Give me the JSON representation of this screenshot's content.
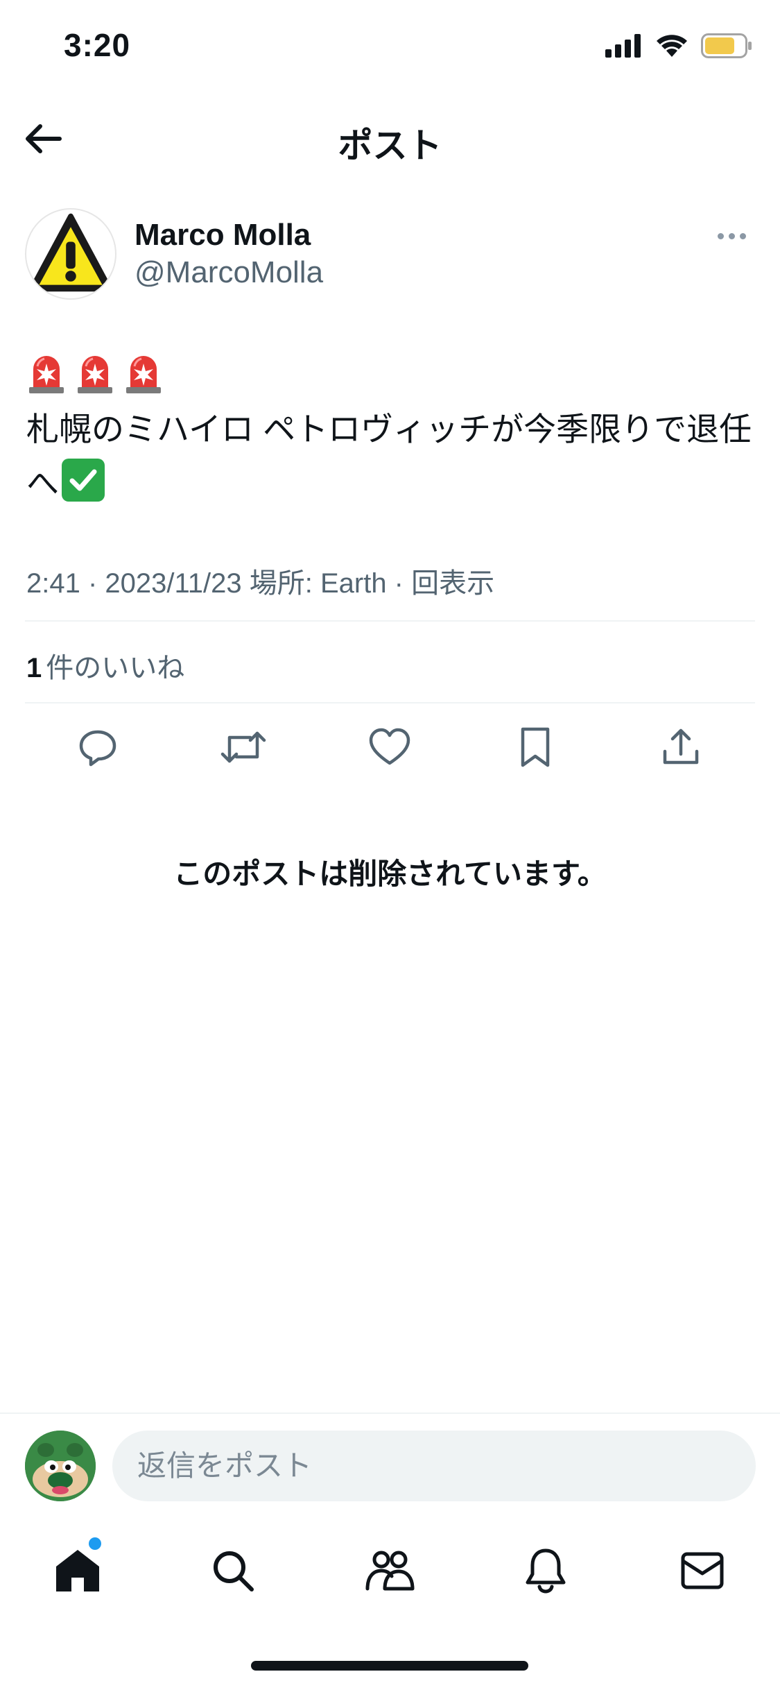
{
  "status_bar": {
    "time": "3:20"
  },
  "header": {
    "title": "ポスト"
  },
  "author": {
    "name": "Marco Molla",
    "handle": "@MarcoMolla",
    "avatar_icon": "warning-icon"
  },
  "post": {
    "emoji_prefix": [
      "siren-icon",
      "siren-icon",
      "siren-icon"
    ],
    "text": "札幌のミハイロ ペトロヴィッチが今季限りで退任へ",
    "emoji_suffix": "check-mark-icon",
    "meta": "2:41 · 2023/11/23 場所: Earth · 回表示"
  },
  "likes": {
    "count": "1",
    "label": "件のいいね"
  },
  "actions": [
    "reply-icon",
    "repost-icon",
    "like-icon",
    "bookmark-icon",
    "share-icon"
  ],
  "deleted_notice": "このポストは削除されています。",
  "reply_bar": {
    "placeholder": "返信をポスト"
  },
  "tab_bar": [
    "home-icon",
    "search-icon",
    "communities-icon",
    "notifications-icon",
    "messages-icon"
  ],
  "colors": {
    "text": "#0f1419",
    "secondary": "#536471",
    "accent": "#1d9bf0",
    "divider": "#eff3f4"
  }
}
